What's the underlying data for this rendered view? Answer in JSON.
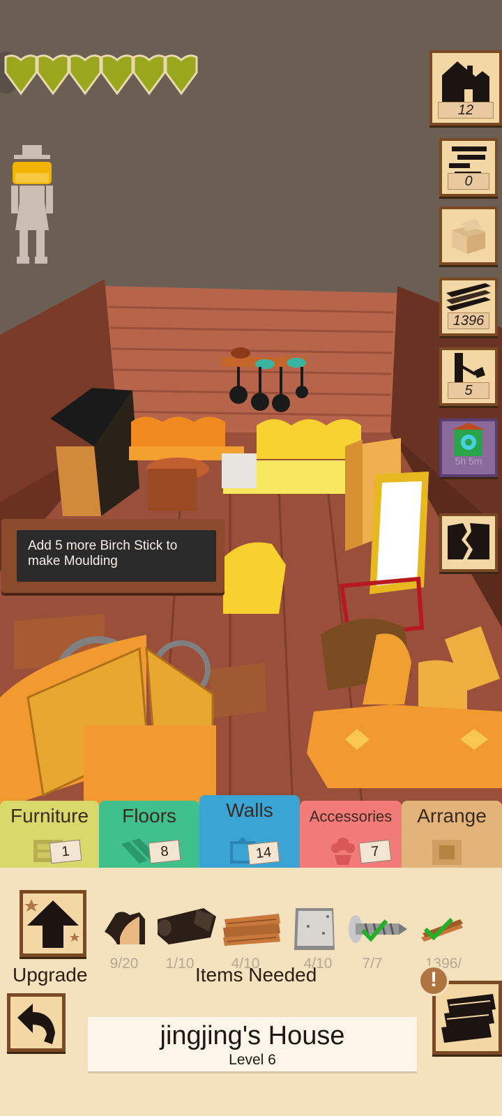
{
  "health": {
    "hearts": 6
  },
  "resources": {
    "house_count": "12",
    "sticks_count": "0",
    "planks_count": "1396",
    "axe_count": "5",
    "chest_timer": "5h 5m"
  },
  "hint": {
    "message": "Add 5 more Birch Stick to make Moulding"
  },
  "tabs": {
    "furniture": {
      "label": "Furniture",
      "count": "1"
    },
    "floors": {
      "label": "Floors",
      "count": "8"
    },
    "walls": {
      "label": "Walls",
      "count": "14"
    },
    "accessories": {
      "label": "Accessories",
      "count": "7"
    },
    "arrange": {
      "label": "Arrange"
    }
  },
  "upgrade": {
    "label": "Upgrade",
    "items_needed_label": "Items Needed",
    "requirements": [
      {
        "icon": "moulding-icon",
        "amount": "9/20"
      },
      {
        "icon": "log-icon",
        "amount": "1/10"
      },
      {
        "icon": "wood-stack-icon",
        "amount": "4/10"
      },
      {
        "icon": "metal-plate-icon",
        "amount": "4/10"
      },
      {
        "icon": "screw-icon",
        "amount": "7/7",
        "complete": true
      },
      {
        "icon": "planks-icon",
        "amount": "1396/",
        "complete": true
      }
    ]
  },
  "house": {
    "name": "jingjing's House",
    "level": "Level 6"
  },
  "colors": {
    "heart": "#9aa61c",
    "tab_furniture": "#d9d86a",
    "tab_floors": "#40c08a",
    "tab_walls": "#3aa4d4",
    "tab_accessories": "#f27a78",
    "tab_arrange": "#e3b47a",
    "check": "#22b02a"
  }
}
